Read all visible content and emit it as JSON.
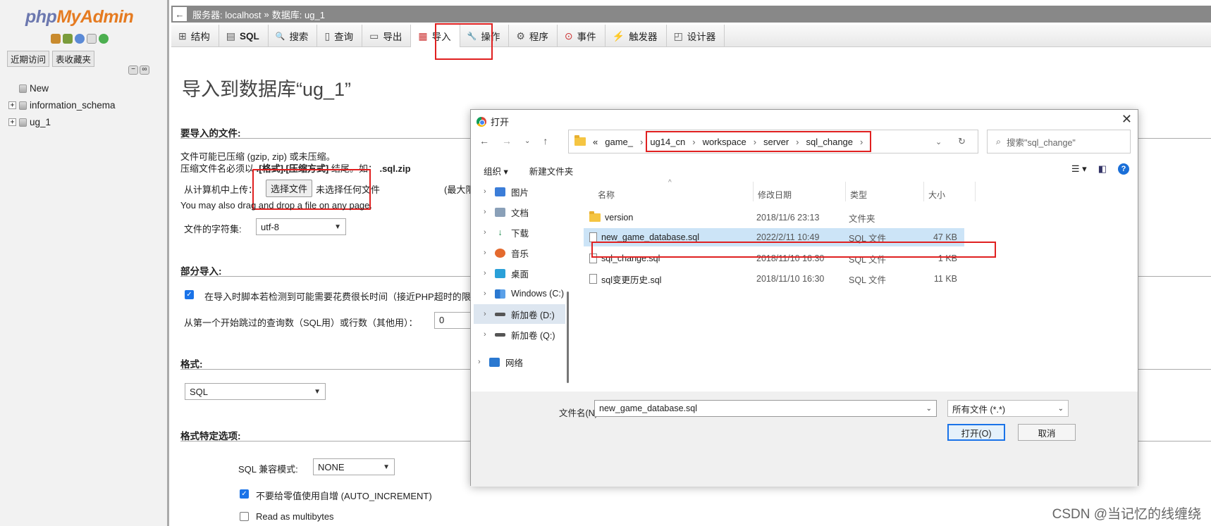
{
  "sidebar": {
    "logo_php": "php",
    "logo_myadmin": "MyAdmin",
    "tabs": [
      "近期访问",
      "表收藏夹"
    ],
    "tree": [
      {
        "label": "New"
      },
      {
        "label": "information_schema"
      },
      {
        "label": "ug_1"
      }
    ]
  },
  "breadcrumb": {
    "back": "←",
    "server": "服务器: localhost",
    "sep": "»",
    "database": "数据库: ug_1"
  },
  "tabs": [
    {
      "label": "结构",
      "icon": "⊞"
    },
    {
      "label": "SQL",
      "icon": "▤"
    },
    {
      "label": "搜索",
      "icon": "🔍"
    },
    {
      "label": "查询",
      "icon": "▯"
    },
    {
      "label": "导出",
      "icon": "▭"
    },
    {
      "label": "导入",
      "icon": "▦"
    },
    {
      "label": "操作",
      "icon": "🔧"
    },
    {
      "label": "程序",
      "icon": "⚙"
    },
    {
      "label": "事件",
      "icon": "⊙"
    },
    {
      "label": "触发器",
      "icon": "⚡"
    },
    {
      "label": "设计器",
      "icon": "◰"
    }
  ],
  "main": {
    "page_title": "导入到数据库“ug_1”",
    "file_section_title": "要导入的文件:",
    "compress_line1": "文件可能已压缩 (gzip, zip) 或未压缩。",
    "compress_line2_a": "压缩文件名必须以",
    "compress_line2_b": ".[格式].[压缩方式]",
    "compress_line2_c": "结尾。如：",
    "compress_line2_d": ".sql.zip",
    "upload_label": "从计算机中上传：",
    "choose_file_button": "选择文件",
    "no_file_text": "未选择任何文件",
    "max_size_text": "(最大限",
    "drag_drop_text": "You may also drag and drop a file on any page.",
    "charset_label": "文件的字符集:",
    "charset_value": "utf-8",
    "partial_section_title": "部分导入:",
    "partial_checkbox_label": "在导入时脚本若检测到可能需要花费很长时间（接近PHP超时的限",
    "skip_label": "从第一个开始跳过的查询数（SQL用）或行数（其他用）：",
    "skip_value": "0",
    "format_section_title": "格式:",
    "format_value": "SQL",
    "format_options_title": "格式特定选项:",
    "sql_compat_label": "SQL 兼容模式:",
    "sql_compat_value": "NONE",
    "auto_inc_label": "不要给零值使用自增 (AUTO_INCREMENT)",
    "multibytes_label": "Read as multibytes"
  },
  "dialog": {
    "title": "打开",
    "close": "✕",
    "path": [
      "«",
      "game_",
      "ug14_cn",
      "workspace",
      "server",
      "sql_change"
    ],
    "search_placeholder": "搜索\"sql_change\"",
    "organize": "组织 ▾",
    "new_folder": "新建文件夹",
    "help": "?",
    "nav_items": [
      {
        "label": "图片"
      },
      {
        "label": "文档"
      },
      {
        "label": "下载"
      },
      {
        "label": "音乐"
      },
      {
        "label": "桌面"
      },
      {
        "label": "Windows (C:)"
      },
      {
        "label": "新加卷 (D:)"
      },
      {
        "label": "新加卷 (Q:)"
      },
      {
        "label": "网络"
      }
    ],
    "columns": [
      "名称",
      "修改日期",
      "类型",
      "大小"
    ],
    "files": [
      {
        "name": "version",
        "date": "2018/11/6 23:13",
        "type": "文件夹",
        "size": ""
      },
      {
        "name": "new_game_database.sql",
        "date": "2022/2/11 10:49",
        "type": "SQL 文件",
        "size": "47 KB"
      },
      {
        "name": "sql_change.sql",
        "date": "2018/11/10 16:30",
        "type": "SQL 文件",
        "size": "1 KB"
      },
      {
        "name": "sql变更历史.sql",
        "date": "2018/11/10 16:30",
        "type": "SQL 文件",
        "size": "11 KB"
      }
    ],
    "filename_label": "文件名(N):",
    "filename_value": "new_game_database.sql",
    "filetype_value": "所有文件 (*.*)",
    "open_button": "打开(O)",
    "cancel_button": "取消"
  },
  "watermark": "CSDN @当记忆的线缠绕",
  "colors": {
    "highlight_red": "#e02020",
    "accent_blue": "#1a73e8",
    "logo_orange": "#e57b21",
    "logo_blue": "#6c78af"
  }
}
